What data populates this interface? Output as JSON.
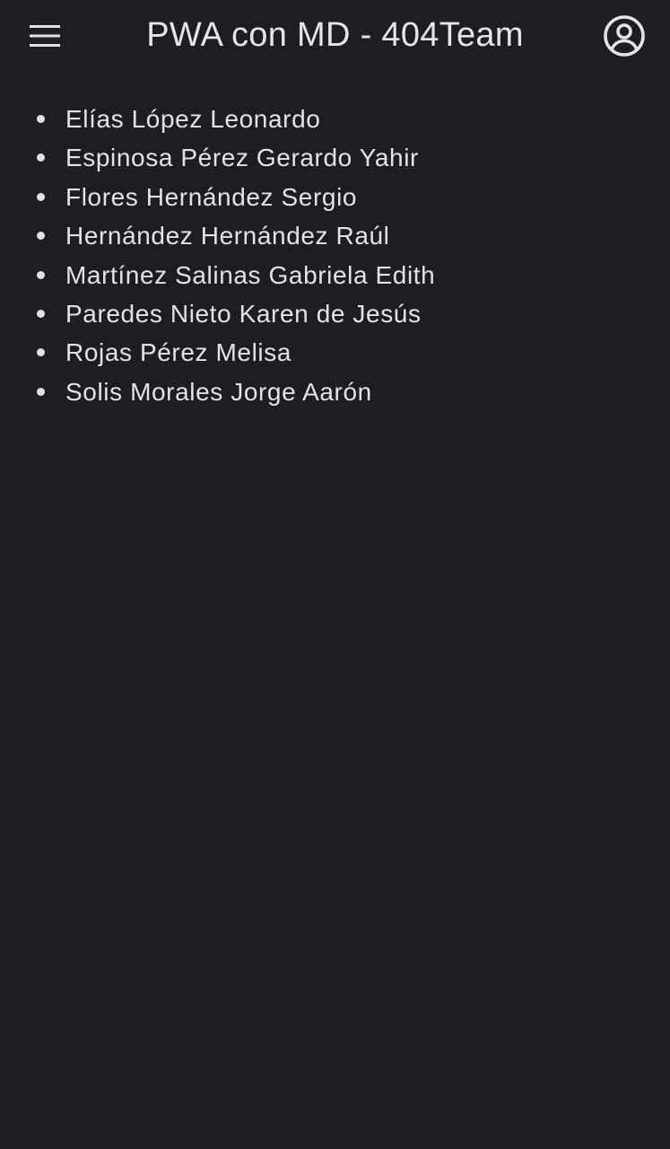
{
  "header": {
    "title": "PWA con MD - 404Team",
    "menu_icon": "hamburger-menu-icon",
    "account_icon": "account-circle-icon"
  },
  "team": {
    "members": [
      "Elías López Leonardo",
      "Espinosa Pérez Gerardo Yahir",
      "Flores Hernández Sergio",
      "Hernández Hernández Raúl",
      "Martínez Salinas Gabriela Edith",
      "Paredes Nieto Karen de Jesús",
      "Rojas Pérez Melisa",
      "Solis Morales Jorge Aarón"
    ]
  },
  "colors": {
    "background": "#1e1d22",
    "text": "#e4e2e8"
  }
}
